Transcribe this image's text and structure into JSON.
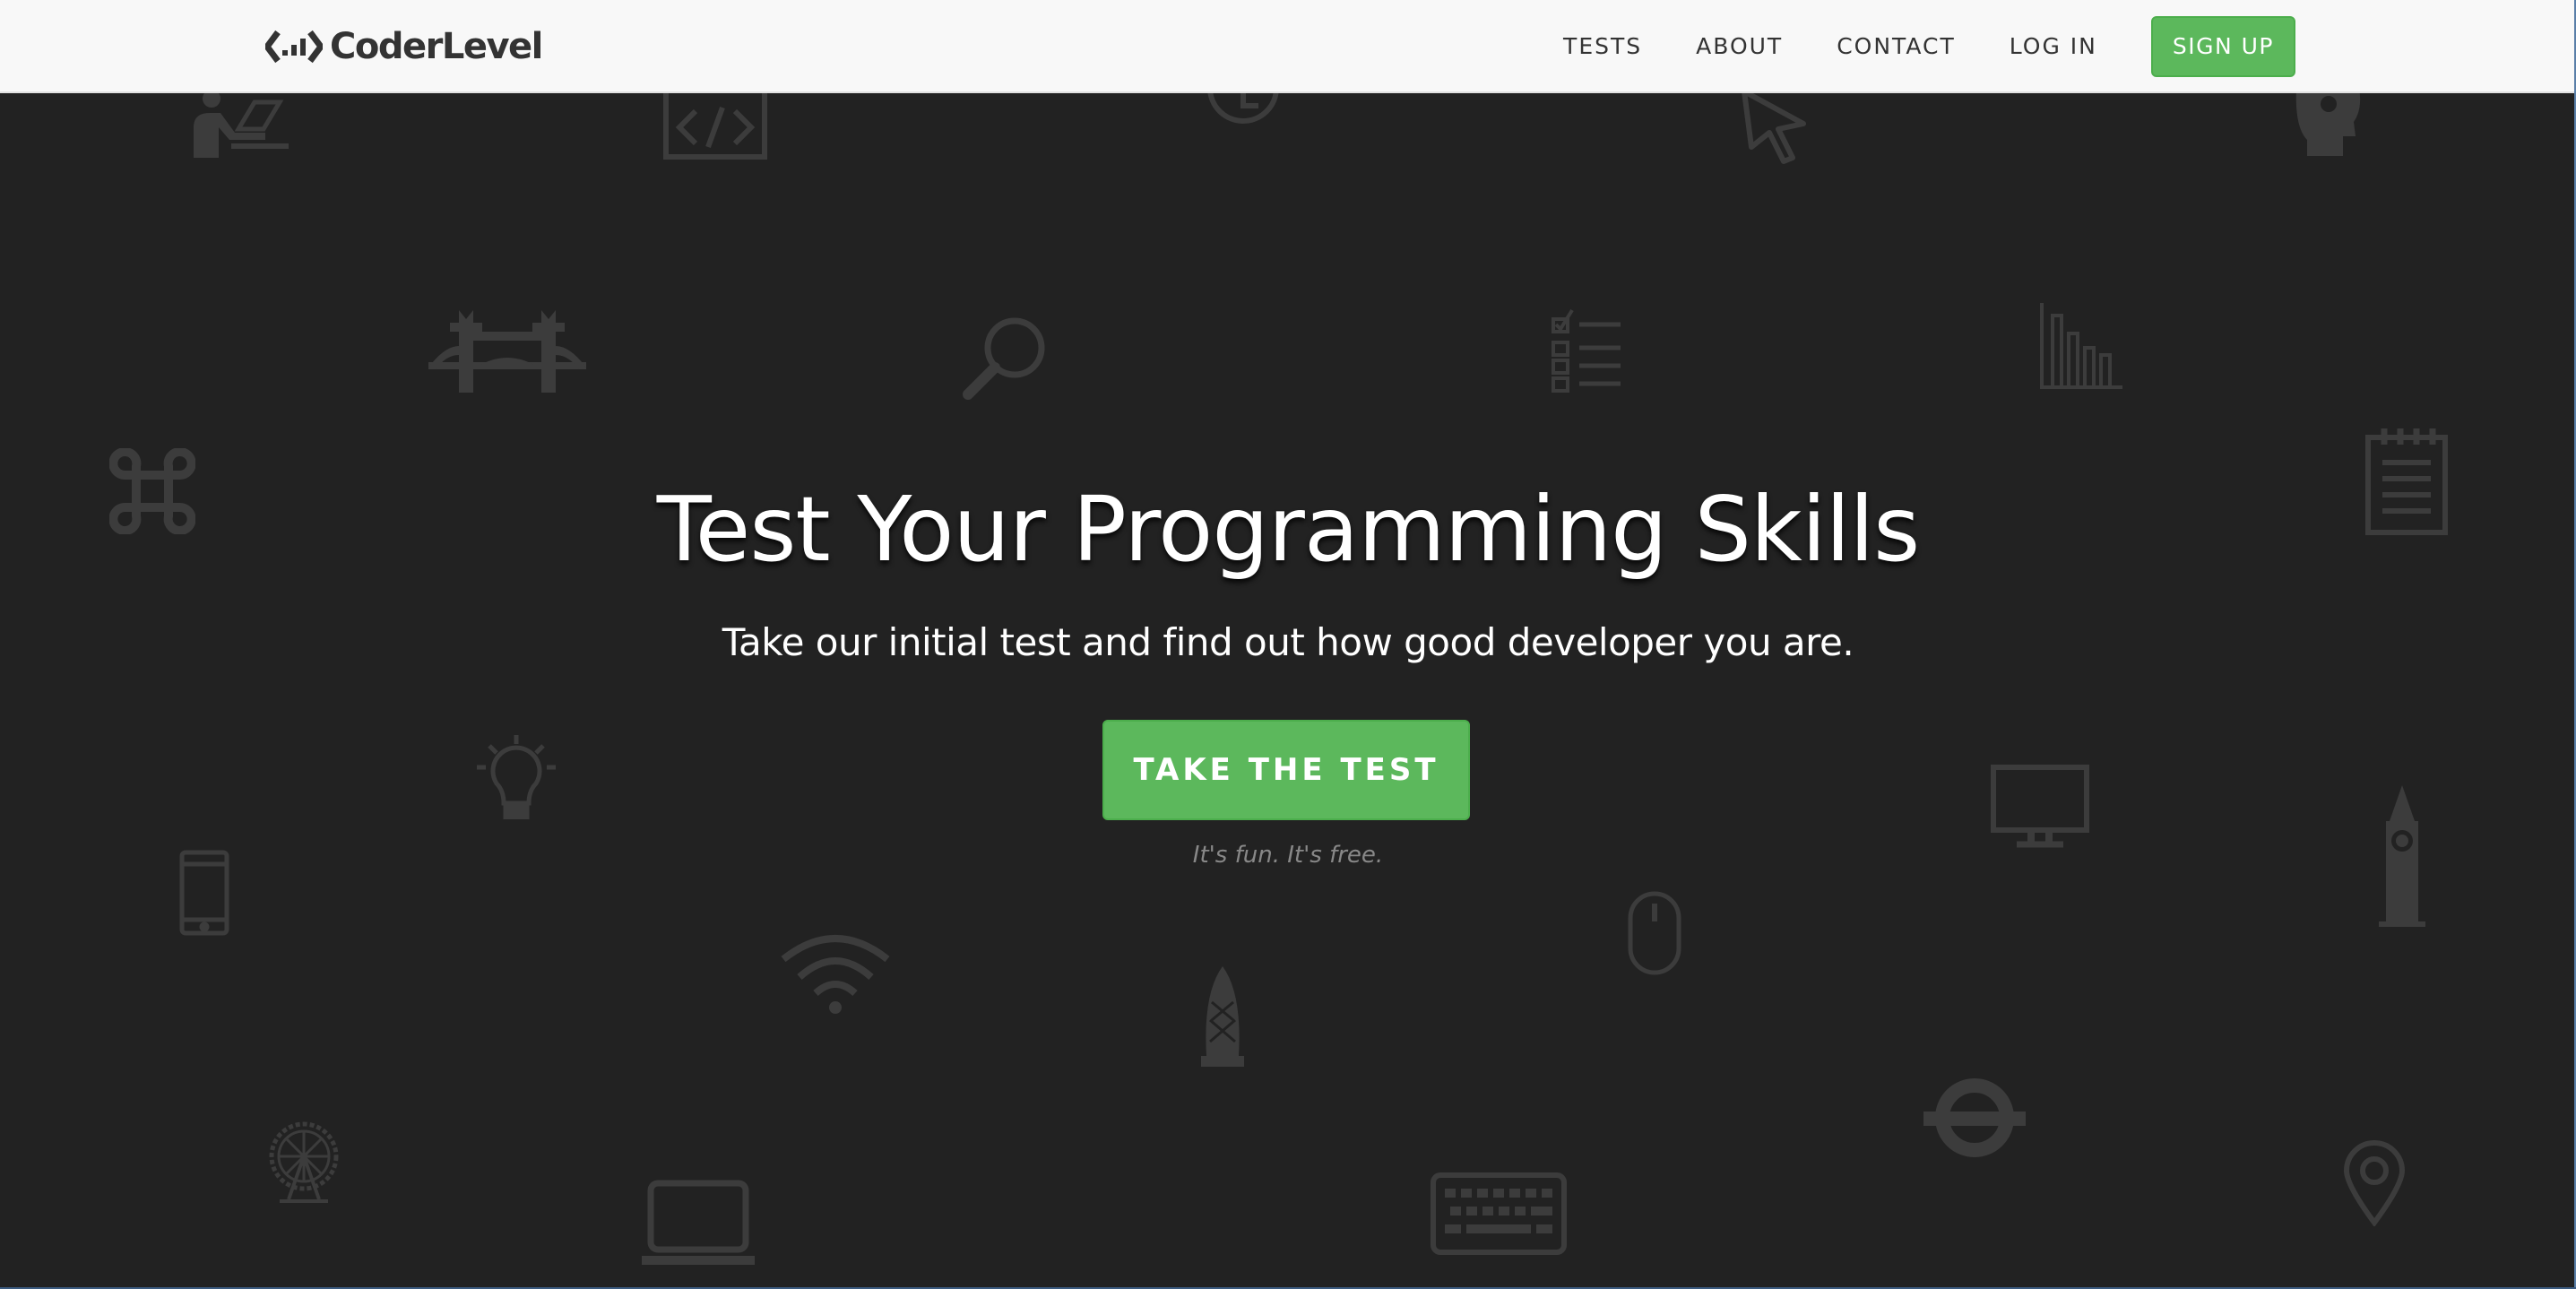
{
  "navbar": {
    "brand": "CoderLevel",
    "links": [
      {
        "label": "TESTS"
      },
      {
        "label": "ABOUT"
      },
      {
        "label": "CONTACT"
      },
      {
        "label": "LOG IN"
      }
    ],
    "signup_label": "SIGN UP"
  },
  "hero": {
    "title": "Test Your Programming Skills",
    "subtitle": "Take our initial test and find out how good developer you are.",
    "cta_label": "TAKE THE TEST",
    "cta_note": "It's fun. It's free."
  },
  "background_icons": [
    "person-laptop-icon",
    "code-tag-icon",
    "clock-icon",
    "cursor-icon",
    "head-gear-icon",
    "tower-bridge-icon",
    "magnifier-icon",
    "checklist-icon",
    "bar-chart-icon",
    "command-key-icon",
    "notepad-icon",
    "lightbulb-icon",
    "monitor-icon",
    "big-ben-icon",
    "phone-icon",
    "mouse-icon",
    "wifi-icon",
    "gherkin-icon",
    "underground-icon",
    "london-eye-icon",
    "laptop-icon",
    "keyboard-icon",
    "map-pin-icon"
  ],
  "colors": {
    "background": "#222222",
    "navbar": "#f8f8f8",
    "accent_green": "#5cb85c",
    "icon": "#3c3c3c"
  }
}
